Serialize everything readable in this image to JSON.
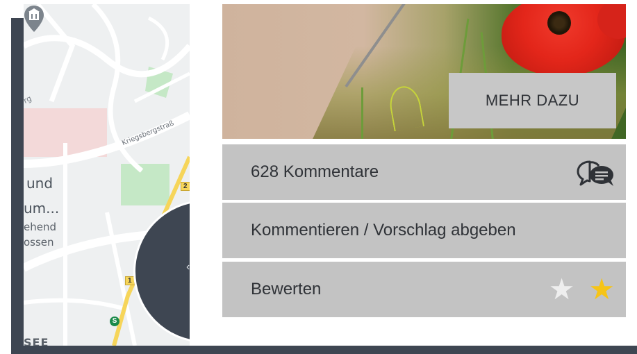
{
  "map": {
    "labels": {
      "und": "und",
      "um": "um...",
      "ehend": "ehend",
      "ossen": "ossen",
      "street": "Kriegsbergstraß",
      "see": "SEE",
      "dg": "rg"
    },
    "road_badges": [
      "2",
      "1"
    ],
    "s_bahn_symbol": "S",
    "colors": {
      "frame": "#3e4652",
      "road_major": "#f6d55a",
      "park": "#c5e8c6",
      "poi_pink": "#f3d6d6"
    }
  },
  "hero": {
    "more_button_label": "MEHR DAZU"
  },
  "actions": {
    "comments_label": "628 Kommentare",
    "suggest_label": "Kommentieren / Vorschlag abgeben",
    "rate_label": "Bewerten",
    "comment_icon": "speech-bubbles-icon",
    "rating": {
      "stars_total": 2,
      "stars_filled": 1
    },
    "star_glyph": "★"
  },
  "colors": {
    "button_bg": "#c3c3c3",
    "text": "#2f3237",
    "star_filled": "#f6c417",
    "star_empty": "#eeeeee"
  }
}
